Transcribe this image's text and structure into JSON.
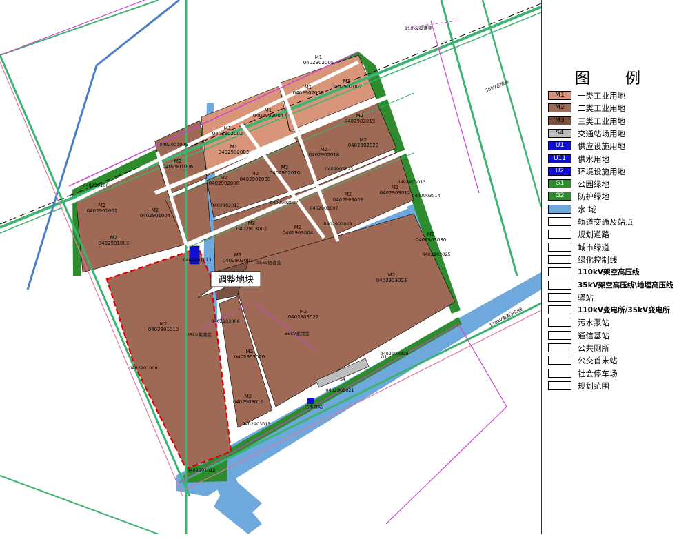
{
  "map": {
    "adjust_label": "调整地块",
    "parcels": [
      {
        "type": "M1",
        "code": "0402902005"
      },
      {
        "type": "M1",
        "code": "0402902006"
      },
      {
        "type": "M1",
        "code": "0402902007"
      },
      {
        "type": "M1",
        "code": "0402902004"
      },
      {
        "type": "M1",
        "code": "0402902002"
      },
      {
        "type": "M1",
        "code": "0402902003"
      },
      {
        "type": "M2",
        "code": "0402902019"
      },
      {
        "type": "M2",
        "code": "0402902018"
      },
      {
        "type": "M2",
        "code": "0402902020"
      },
      {
        "type": "M2",
        "code": "0402902010"
      },
      {
        "type": "M2",
        "code": "0402902009"
      },
      {
        "type": "M2",
        "code": "0402902008"
      },
      {
        "type": "M2",
        "code": "0402901006"
      },
      {
        "type": "M2",
        "code": "0402901002"
      },
      {
        "type": "M2",
        "code": "0402901004"
      },
      {
        "type": "M2",
        "code": "0402901003"
      },
      {
        "type": "M2",
        "code": "0402903009"
      },
      {
        "type": "M2",
        "code": "0402903012"
      },
      {
        "type": "M2",
        "code": "0402903004"
      },
      {
        "type": "M2",
        "code": "0402903002"
      },
      {
        "type": "M3",
        "code": "0402903001"
      },
      {
        "type": "M2",
        "code": "0402903023"
      },
      {
        "type": "M2",
        "code": "0402903022"
      },
      {
        "type": "M2",
        "code": "0402901010"
      },
      {
        "type": "M2",
        "code": "0402903020"
      },
      {
        "type": "M2",
        "code": "0402903018"
      },
      {
        "type": "M2",
        "code": "0402903030"
      }
    ],
    "misc_labels": [
      {
        "id": "sub110",
        "text": "110kV秦港变"
      },
      {
        "id": "sub35a",
        "text": "35kV协鑫变"
      },
      {
        "id": "sub35b",
        "text": "35kV莱港变"
      },
      {
        "id": "sub35c",
        "text": "35kV莱港变"
      },
      {
        "id": "c1001",
        "text": "0402901001"
      },
      {
        "id": "c1005",
        "text": "0402901005"
      },
      {
        "id": "c1009",
        "text": "0402901009"
      },
      {
        "id": "c1012",
        "text": "0402901012"
      },
      {
        "id": "c1013",
        "text": "0402901013"
      },
      {
        "id": "c2013",
        "text": "0402902013"
      },
      {
        "id": "c2017",
        "text": "0402902017"
      },
      {
        "id": "c2022",
        "text": "0402902022"
      },
      {
        "id": "c3007",
        "text": "0402903007"
      },
      {
        "id": "c3008",
        "text": "0402903008"
      },
      {
        "id": "c3013",
        "text": "0402903013"
      },
      {
        "id": "c3014",
        "text": "0402903014"
      },
      {
        "id": "c3025",
        "text": "0402903025"
      },
      {
        "id": "c3028",
        "text": "0402903028"
      },
      {
        "id": "c3021",
        "text": "0402903021"
      },
      {
        "id": "c3006",
        "text": "0402903006"
      },
      {
        "id": "c3015",
        "text": "0402903015"
      },
      {
        "id": "pump",
        "text": "污水泵站"
      },
      {
        "id": "rdA",
        "text": "35kV古塘线"
      },
      {
        "id": "rdB",
        "text": "110kV秦港汾口线"
      },
      {
        "id": "s4",
        "text": "S4"
      },
      {
        "id": "g1",
        "text": "G1"
      }
    ]
  },
  "legend": {
    "title": "图  例",
    "items": [
      {
        "code": "M1",
        "label": "一类工业用地",
        "color": "#d9957a",
        "bold": false
      },
      {
        "code": "M2",
        "label": "二类工业用地",
        "color": "#9e6a56",
        "bold": false
      },
      {
        "code": "M3",
        "label": "三类工业用地",
        "color": "#7b5242",
        "bold": false
      },
      {
        "code": "S4",
        "label": "交通站场用地",
        "color": "#bdbdbd",
        "bold": false
      },
      {
        "code": "U1",
        "label": "供应设施用地",
        "color": "#1010d0",
        "bold": false
      },
      {
        "code": "U11",
        "label": "供水用地",
        "color": "#1010d0",
        "bold": false
      },
      {
        "code": "U2",
        "label": "环境设施用地",
        "color": "#1010d0",
        "bold": false
      },
      {
        "code": "G1",
        "label": "公园绿地",
        "color": "#2e8b2e",
        "bold": false
      },
      {
        "code": "G2",
        "label": "防护绿地",
        "color": "#2e8b2e",
        "bold": false
      },
      {
        "code": "",
        "label": "水  域",
        "color": "#6fa8dc",
        "bold": false
      },
      {
        "code": "",
        "label": "轨道交通及站点",
        "color": "#ffffff",
        "bold": false
      },
      {
        "code": "",
        "label": "规划道路",
        "color": "#ffffff",
        "bold": false
      },
      {
        "code": "",
        "label": "城市绿道",
        "color": "#ffffff",
        "bold": false
      },
      {
        "code": "",
        "label": "绿化控制线",
        "color": "#ffffff",
        "bold": false
      },
      {
        "code": "",
        "label": "110kV架空高压线",
        "color": "#ffffff",
        "bold": true
      },
      {
        "code": "",
        "label": "35kV架空高压线\\地埋高压线",
        "color": "#ffffff",
        "bold": true
      },
      {
        "code": "",
        "label": "驿站",
        "color": "#ffffff",
        "bold": false
      },
      {
        "code": "",
        "label": "110kV变电所/35kV变电所",
        "color": "#ffffff",
        "bold": true
      },
      {
        "code": "",
        "label": "污水泵站",
        "color": "#ffffff",
        "bold": false
      },
      {
        "code": "",
        "label": "通信基站",
        "color": "#ffffff",
        "bold": false
      },
      {
        "code": "",
        "label": "公共厕所",
        "color": "#ffffff",
        "bold": false
      },
      {
        "code": "",
        "label": "公交首末站",
        "color": "#ffffff",
        "bold": false
      },
      {
        "code": "",
        "label": "社会停车场",
        "color": "#ffffff",
        "bold": false
      },
      {
        "code": "",
        "label": "规划范围",
        "color": "#ffffff",
        "bold": false
      }
    ]
  },
  "colors": {
    "m1": "#d9957a",
    "m2": "#9e6a56",
    "m3": "#7b5242",
    "green": "#2e8b2e",
    "water": "#6fa8dc",
    "road_green": "#3cb371",
    "road_pink": "#e07aa0",
    "boundary": "#cc44cc",
    "adjust": "#e00000"
  }
}
